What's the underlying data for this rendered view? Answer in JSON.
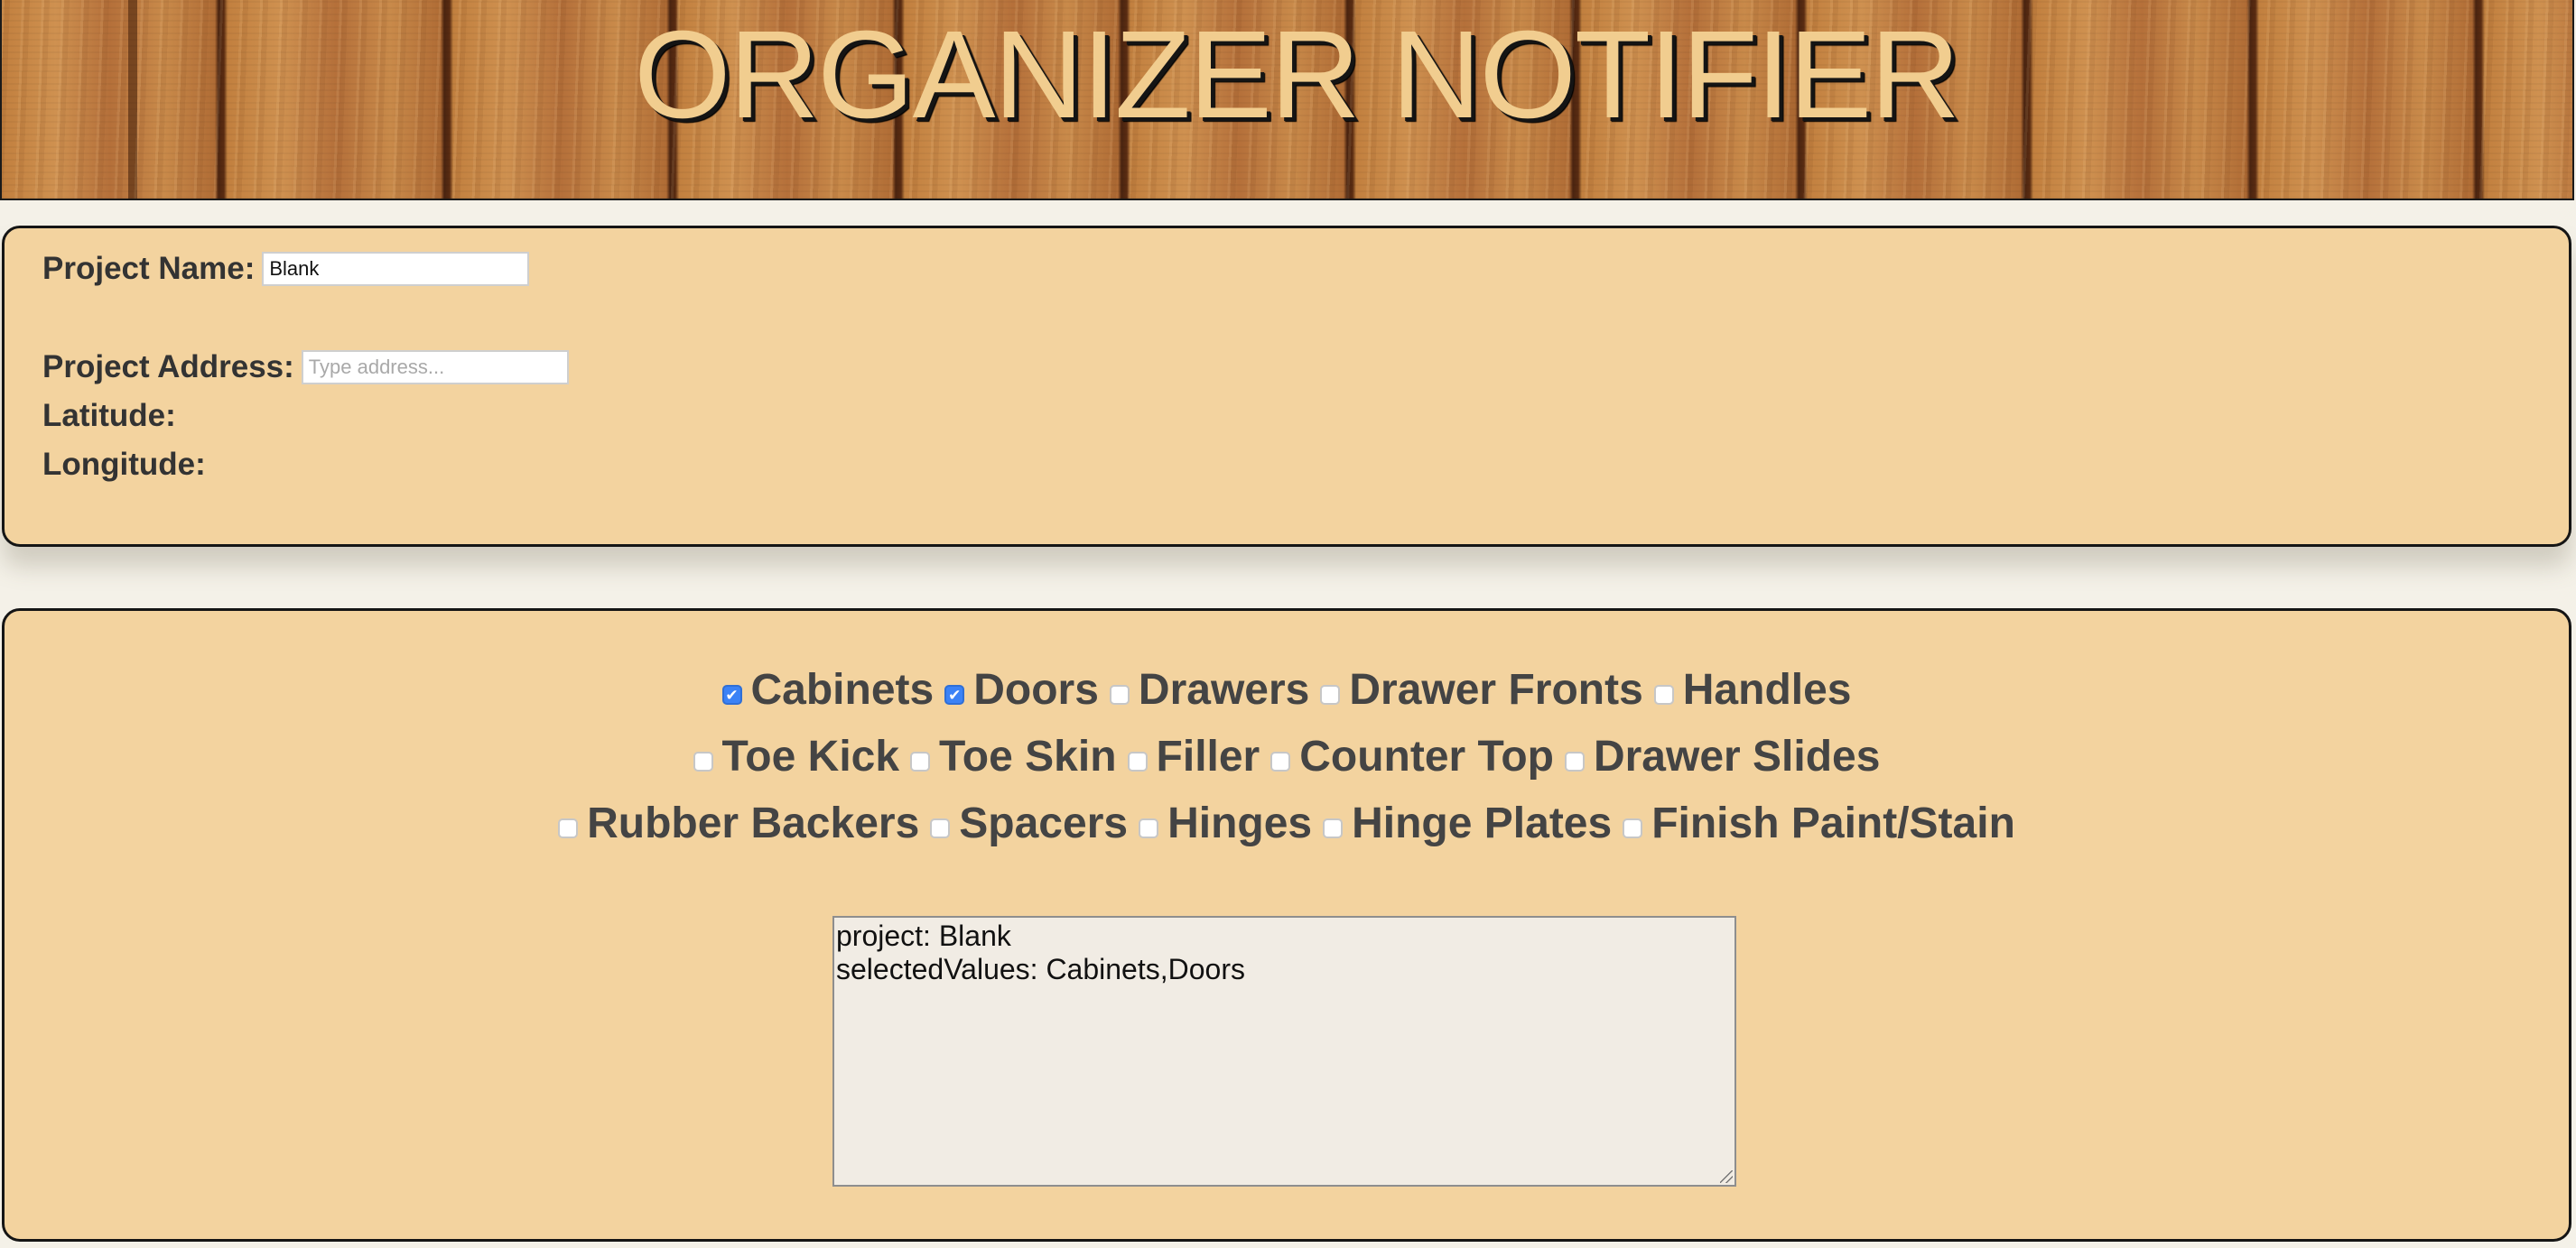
{
  "header": {
    "title": "ORGANIZER NOTIFIER"
  },
  "project": {
    "name_label": "Project Name:",
    "name_value": "Blank",
    "address_label": "Project Address:",
    "address_value": "",
    "address_placeholder": "Type address...",
    "latitude_label": "Latitude:",
    "longitude_label": "Longitude:"
  },
  "options": {
    "rows": [
      [
        {
          "label": "Cabinets",
          "checked": true
        },
        {
          "label": "Doors",
          "checked": true
        },
        {
          "label": "Drawers",
          "checked": false
        },
        {
          "label": "Drawer Fronts",
          "checked": false
        },
        {
          "label": "Handles",
          "checked": false
        }
      ],
      [
        {
          "label": "Toe Kick",
          "checked": false
        },
        {
          "label": "Toe Skin",
          "checked": false
        },
        {
          "label": "Filler",
          "checked": false
        },
        {
          "label": "Counter Top",
          "checked": false
        },
        {
          "label": "Drawer Slides",
          "checked": false
        }
      ],
      [
        {
          "label": "Rubber Backers",
          "checked": false
        },
        {
          "label": "Spacers",
          "checked": false
        },
        {
          "label": "Hinges",
          "checked": false
        },
        {
          "label": "Hinge Plates",
          "checked": false
        },
        {
          "label": "Finish Paint/Stain",
          "checked": false
        }
      ]
    ]
  },
  "output": {
    "lines": [
      "project: Blank",
      "selectedValues: Cabinets,Doors"
    ]
  },
  "colors": {
    "panel_background": "#f3d39f",
    "title_color": "#f1cd8f",
    "checkbox_checked": "#3b82f6",
    "page_background": "#f4f1e8"
  }
}
